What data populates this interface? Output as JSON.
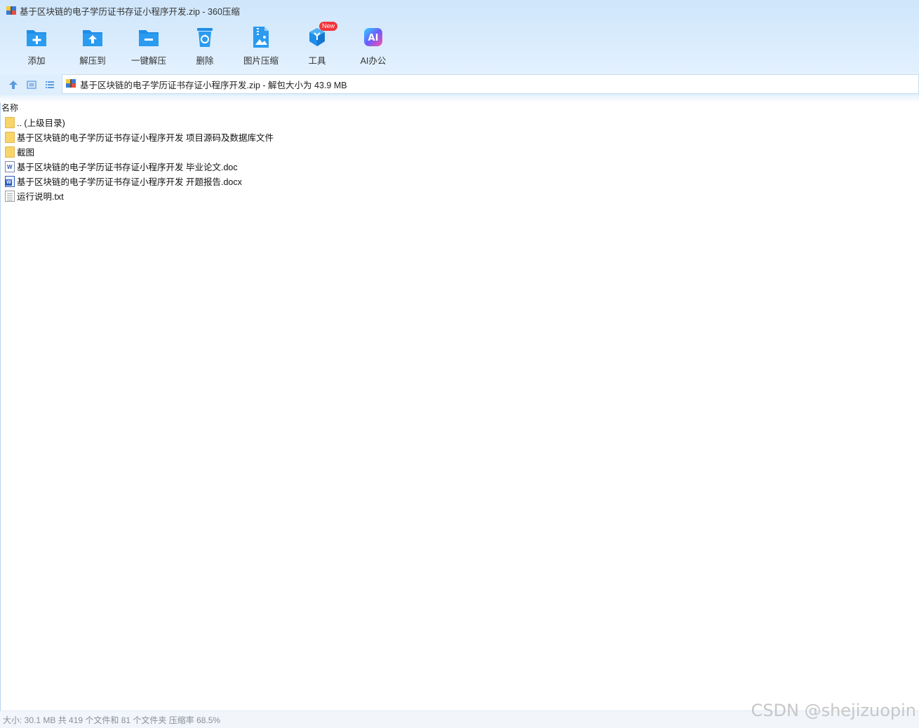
{
  "window": {
    "title": "基于区块链的电子学历证书存证小程序开发.zip - 360压缩"
  },
  "toolbar": {
    "items": [
      {
        "label": "添加",
        "icon": "add-folder-icon"
      },
      {
        "label": "解压到",
        "icon": "extract-to-icon"
      },
      {
        "label": "一键解压",
        "icon": "one-click-extract-icon"
      },
      {
        "label": "删除",
        "icon": "recycle-bin-icon"
      },
      {
        "label": "图片压缩",
        "icon": "image-compress-icon"
      },
      {
        "label": "工具",
        "icon": "tools-cube-icon",
        "badge": "New"
      },
      {
        "label": "AI办公",
        "icon": "ai-office-icon"
      }
    ]
  },
  "nav": {
    "address": "基于区块链的电子学历证书存证小程序开发.zip - 解包大小为 43.9 MB",
    "buttons": [
      "up-arrow-icon",
      "view-thumbnail-icon",
      "view-list-icon"
    ]
  },
  "list": {
    "column_name": "名称",
    "items": [
      {
        "name": ".. (上级目录)",
        "type": "folder"
      },
      {
        "name": "基于区块链的电子学历证书存证小程序开发 项目源码及数据库文件",
        "type": "folder"
      },
      {
        "name": "截图",
        "type": "folder"
      },
      {
        "name": "基于区块链的电子学历证书存证小程序开发 毕业论文.doc",
        "type": "doc"
      },
      {
        "name": "基于区块链的电子学历证书存证小程序开发 开题报告.docx",
        "type": "docx"
      },
      {
        "name": "运行说明.txt",
        "type": "txt"
      }
    ]
  },
  "status": {
    "text": "大小: 30.1 MB 共 419 个文件和 81 个文件夹 压缩率 68.5%"
  },
  "watermark": "CSDN @shejizuopin",
  "colors": {
    "accent": "#1f8ee8",
    "badge": "#f2353b",
    "folder": "#f7d56b"
  }
}
